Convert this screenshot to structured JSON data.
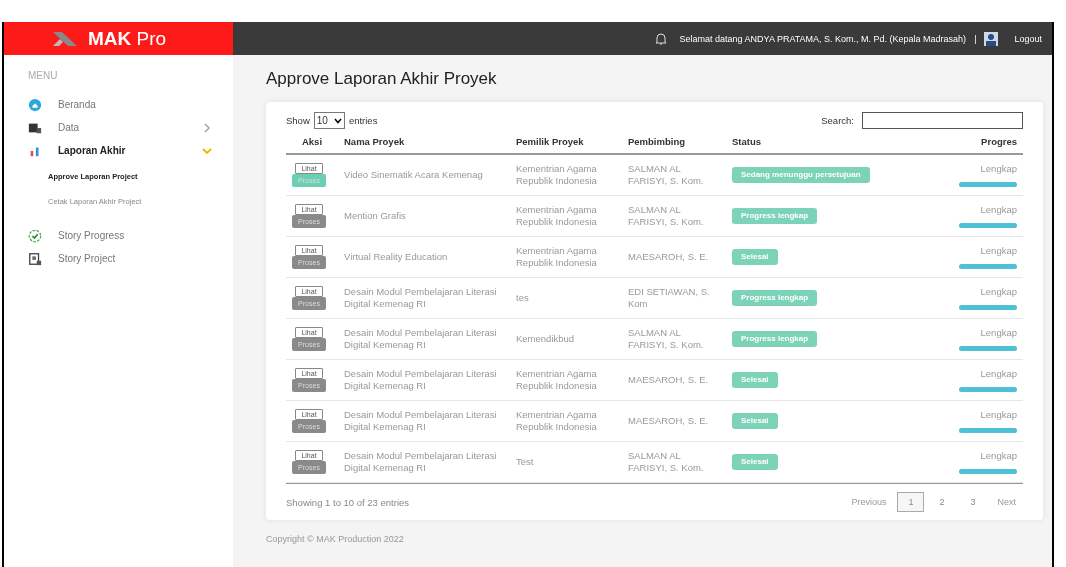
{
  "header": {
    "brand_bold": "MAK",
    "brand_light": "Pro",
    "welcome": "Selamat datang ANDYA PRATAMA, S. Kom., M. Pd. (Kepala Madrasah)",
    "separator": "|",
    "logout": "Logout"
  },
  "sidebar": {
    "heading": "MENU",
    "items": [
      {
        "label": "Beranda",
        "kind": "link",
        "selected": false
      },
      {
        "label": "Data",
        "kind": "group",
        "selected": false,
        "expanded": false
      },
      {
        "label": "Laporan Akhir",
        "kind": "group",
        "selected": true,
        "expanded": true,
        "children": [
          {
            "label": "Approve Laporan Project",
            "selected": true
          },
          {
            "label": "Cetak Laporan Akhir Project",
            "selected": false
          }
        ]
      },
      {
        "label": "Story Progress",
        "kind": "link",
        "selected": false
      },
      {
        "label": "Story Project",
        "kind": "link",
        "selected": false
      }
    ]
  },
  "page_title": "Approve Laporan Akhir Proyek",
  "table": {
    "show_label": "Show",
    "page_size": "10",
    "entries_label": "entries",
    "search_label": "Search:",
    "columns": [
      "Aksi",
      "Nama Proyek",
      "Pemilik Proyek",
      "Pembimbing",
      "Status",
      "Progres"
    ],
    "rows": [
      {
        "view": "Lihat",
        "process": "Proses",
        "process_active": true,
        "name": "Video Sinematik Acara Kemenag",
        "owner": "Kementrian Agama Republik Indonesia",
        "mentor": "SALMAN AL FARISYI, S. Kom.",
        "status": "Sedang menunggu persetujuan",
        "progress_label": "Lengkap",
        "level": 1
      },
      {
        "view": "Lihat",
        "process": "Proses",
        "process_active": false,
        "name": "Mention Grafis",
        "owner": "Kementrian Agama Republik Indonesia",
        "mentor": "SALMAN AL FARISYI, S. Kom.",
        "status": "Progress lengkap",
        "progress_label": "Lengkap",
        "level": 1
      },
      {
        "view": "Lihat",
        "process": "Proses",
        "process_active": false,
        "name": "Virtual Reality Education",
        "owner": "Kementrian Agama Republik Indonesia",
        "mentor": "MAESAROH, S. E.",
        "status": "Selesai",
        "progress_label": "Lengkap",
        "level": 1
      },
      {
        "view": "Lihat",
        "process": "Proses",
        "process_active": false,
        "name": "Desain Modul Pembelajaran Literasi Digital Kemenag RI",
        "owner": "tes",
        "mentor": "EDI SETIAWAN, S. Kom",
        "status": "Progress lengkap",
        "progress_label": "Lengkap",
        "level": 1
      },
      {
        "view": "Lihat",
        "process": "Proses",
        "process_active": false,
        "name": "Desain Modul Pembelajaran Literasi Digital Kemenag RI",
        "owner": "Kemendikbud",
        "mentor": "SALMAN AL FARISYI, S. Kom.",
        "status": "Progress lengkap",
        "progress_label": "Lengkap",
        "level": 1
      },
      {
        "view": "Lihat",
        "process": "Proses",
        "process_active": false,
        "name": "Desain Modul Pembelajaran Literasi Digital Kemenag RI",
        "owner": "Kementrian Agama Republik Indonesia",
        "mentor": "MAESAROH, S. E.",
        "status": "Selesai",
        "progress_label": "Lengkap",
        "level": 1
      },
      {
        "view": "Lihat",
        "process": "Proses",
        "process_active": false,
        "name": "Desain Modul Pembelajaran Literasi Digital Kemenag RI",
        "owner": "Kementrian Agama Republik Indonesia",
        "mentor": "MAESAROH, S. E.",
        "status": "Selesai",
        "progress_label": "Lengkap",
        "level": 1
      },
      {
        "view": "Lihat",
        "process": "Proses",
        "process_active": false,
        "name": "Desain Modul Pembelajaran Literasi Digital Kemenag RI",
        "owner": "Test",
        "mentor": "SALMAN AL FARISYI, S. Kom.",
        "status": "Selesai",
        "progress_label": "Lengkap",
        "level": 1
      }
    ],
    "info": "Showing 1 to 10 of 23 entries",
    "pagination": [
      {
        "label": "Previous",
        "kind": "nav",
        "selected": false
      },
      {
        "label": "1",
        "kind": "page",
        "selected": true
      },
      {
        "label": "2",
        "kind": "page",
        "selected": false
      },
      {
        "label": "3",
        "kind": "page",
        "selected": false
      },
      {
        "label": "Next",
        "kind": "nav",
        "selected": false
      }
    ]
  },
  "footer": "Copyright © MAK Production 2022"
}
